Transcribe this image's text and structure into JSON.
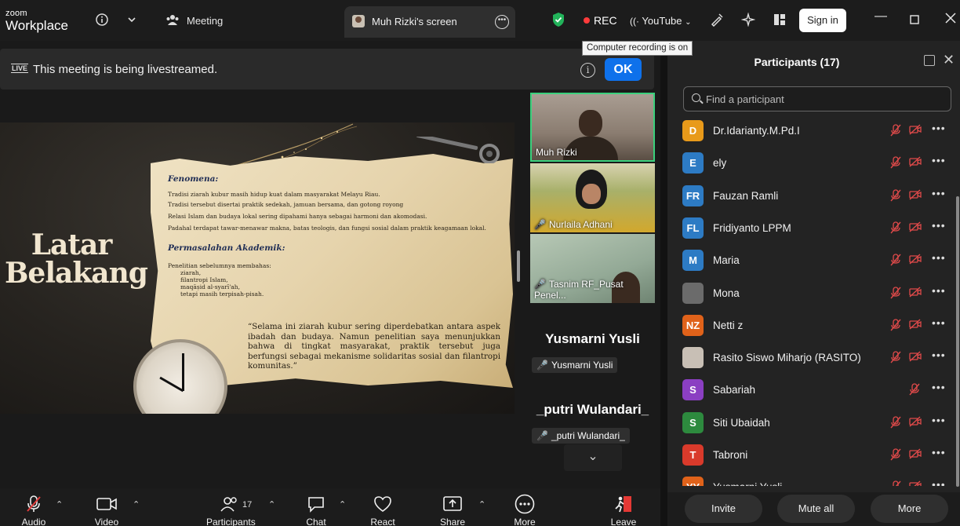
{
  "app": {
    "brand_top": "zoom",
    "brand_bottom": "Workplace"
  },
  "topbar": {
    "meeting_label": "Meeting",
    "screen_tab_label": "Muh Rizki's screen",
    "rec_label": "REC",
    "youtube_label": "YouTube",
    "signin_label": "Sign in",
    "tooltip": "Computer recording is on"
  },
  "banner": {
    "live_badge": "LIVE",
    "message": "This meeting is being livestreamed.",
    "ok_label": "OK"
  },
  "slide": {
    "title_line1": "Latar",
    "title_line2": "Belakang",
    "heading1": "Fenomena:",
    "lines1": [
      "Tradisi ziarah kubur masih hidup kuat dalam masyarakat Melayu Riau.",
      "Tradisi tersebut disertai praktik sedekah, jamuan bersama, dan gotong royong",
      "Relasi Islam dan budaya lokal sering dipahami hanya sebagai harmoni dan akomodasi.",
      "Padahal terdapat tawar-menawar makna, batas teologis, dan fungsi sosial dalam praktik keagamaan lokal."
    ],
    "heading2": "Permasalahan Akademik:",
    "lines2": [
      "Penelitian sebelumnya membahas:",
      "ziarah,",
      "filantropi Islam,",
      "maqāṣid al-syarī'ah,",
      "tetapi masih terpisah-pisah."
    ],
    "quote": "“Selama ini ziarah kubur sering diperdebatkan antara aspek ibadah dan budaya. Namun penelitian saya menunjukkan bahwa di tingkat masyarakat, praktik tersebut juga berfungsi sebagai mekanisme solidaritas sosial dan filantropi komunitas.”"
  },
  "videos": {
    "tiles": [
      {
        "name": "Muh Rizki"
      },
      {
        "name": "Nurlaila Adhani"
      },
      {
        "name": "Tasnim RF_Pusat Penel..."
      }
    ],
    "name_tiles": [
      {
        "big": "Yusmarni Yusli",
        "small": "Yusmarni Yusli"
      },
      {
        "big": "_putri Wulandari_",
        "small": "_putri Wulandari_"
      }
    ]
  },
  "toolbar": {
    "audio": "Audio",
    "video": "Video",
    "participants": "Participants",
    "participants_count": "17",
    "chat": "Chat",
    "react": "React",
    "share": "Share",
    "more": "More",
    "leave": "Leave"
  },
  "panel": {
    "title": "Participants (17)",
    "search_placeholder": "Find a participant",
    "participants": [
      {
        "initials": "D",
        "name": "Dr.Idarianty.M.Pd.I",
        "color": "#e89a1a"
      },
      {
        "initials": "E",
        "name": "ely",
        "color": "#2d7bc4"
      },
      {
        "initials": "FR",
        "name": "Fauzan Ramli",
        "color": "#2d7bc4"
      },
      {
        "initials": "FL",
        "name": "Fridiyanto LPPM",
        "color": "#2d7bc4"
      },
      {
        "initials": "M",
        "name": "Maria",
        "color": "#2d7bc4"
      },
      {
        "initials": "",
        "name": "Mona",
        "color": "#6b6b6b"
      },
      {
        "initials": "NZ",
        "name": "Netti z",
        "color": "#e0621a"
      },
      {
        "initials": "",
        "name": "Rasito Siswo Miharjo (RASITO)",
        "color": "#c8bfb5"
      },
      {
        "initials": "S",
        "name": "Sabariah",
        "color": "#8b3fc2"
      },
      {
        "initials": "S",
        "name": "Siti Ubaidah",
        "color": "#2d8a3e"
      },
      {
        "initials": "T",
        "name": "Tabroni",
        "color": "#d93a2b"
      },
      {
        "initials": "YY",
        "name": "Yusmarni Yusli",
        "color": "#e0621a"
      }
    ],
    "invite": "Invite",
    "mute_all": "Mute all",
    "more": "More"
  }
}
